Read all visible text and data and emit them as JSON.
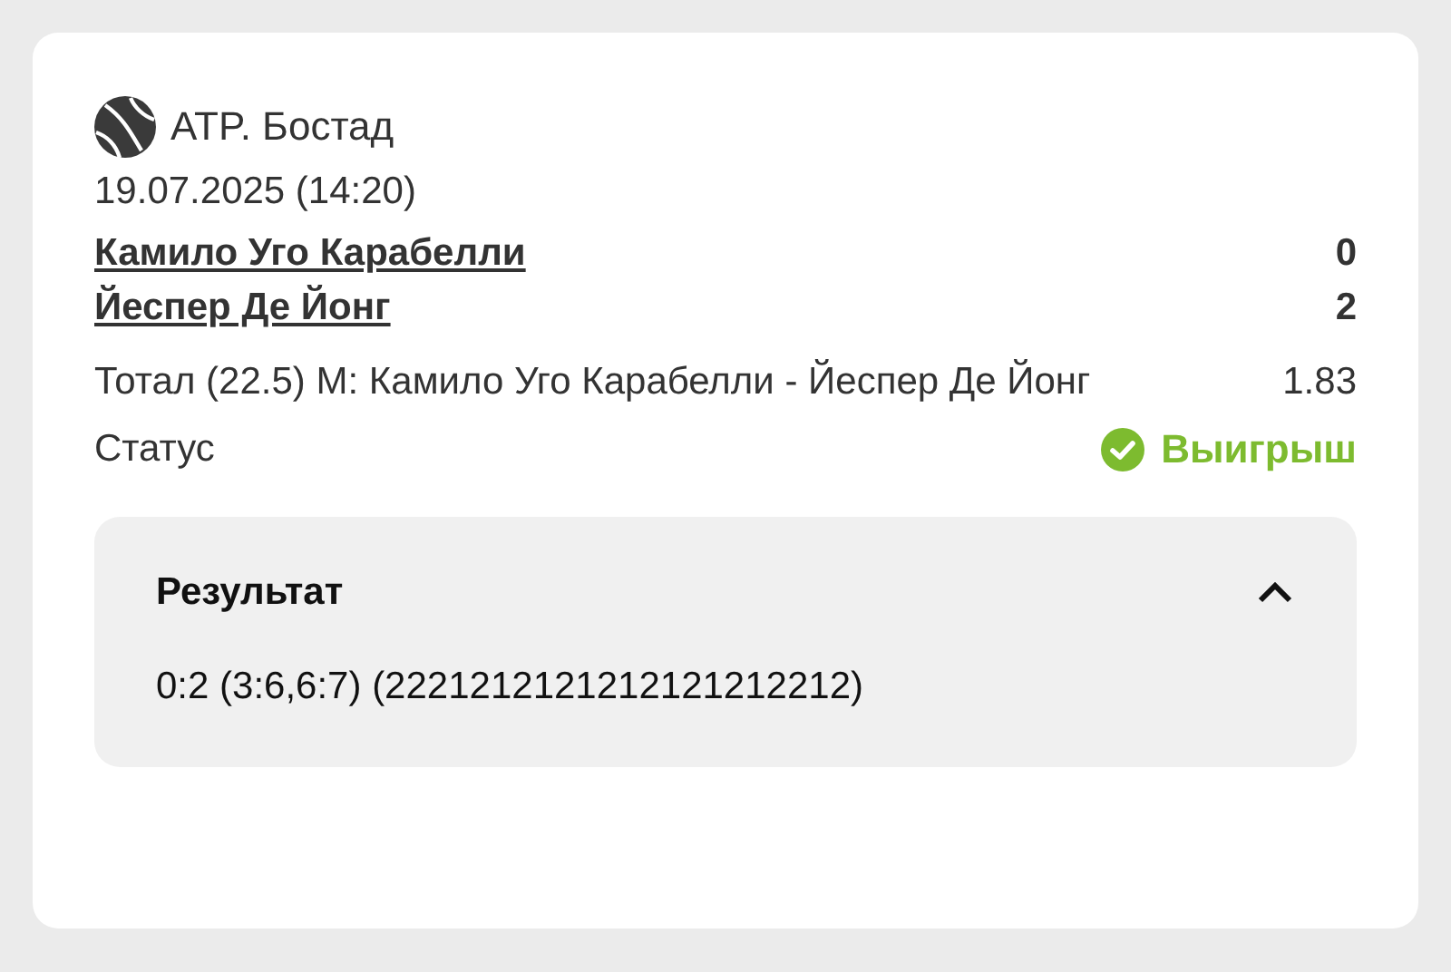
{
  "tournament": "ATP. Бостад",
  "datetime": "19.07.2025 (14:20)",
  "players": [
    {
      "name": "Камило Уго Карабелли",
      "score": "0"
    },
    {
      "name": "Йеспер Де Йонг",
      "score": "2"
    }
  ],
  "bet": {
    "market": "Тотал (22.5) М: Камило Уго Карабелли - Йеспер Де Йонг",
    "odds": "1.83"
  },
  "status": {
    "label": "Статус",
    "value": "Выигрыш",
    "kind": "won"
  },
  "result": {
    "title": "Результат",
    "expanded": true,
    "text": "0:2 (3:6,6:7) (2221212121212121212212)"
  }
}
